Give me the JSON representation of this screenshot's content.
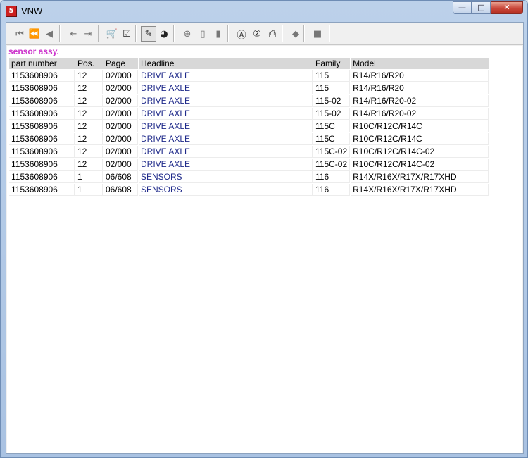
{
  "window": {
    "title": "VNW",
    "icon": "app-icon",
    "min_symbol": "—",
    "max_symbol": "□",
    "close_symbol": "✕"
  },
  "toolbar": {
    "buttons": [
      {
        "name": "first-record-icon",
        "glyph": "⏮"
      },
      {
        "name": "previous-page-icon",
        "glyph": "⏪"
      },
      {
        "name": "previous-record-icon",
        "glyph": "◀"
      },
      {
        "name": "export-icon",
        "glyph": "⇤"
      },
      {
        "name": "import-icon",
        "glyph": "⇥"
      },
      {
        "name": "cart-icon",
        "glyph": "🛒"
      },
      {
        "name": "checklist-icon",
        "glyph": "☑"
      },
      {
        "name": "bookmark-icon",
        "glyph": "✎"
      },
      {
        "name": "globe-icon",
        "glyph": "◕"
      },
      {
        "name": "zoom-in-icon",
        "glyph": "⊕"
      },
      {
        "name": "page-icon",
        "glyph": "▯"
      },
      {
        "name": "page-copy-icon",
        "glyph": "▮"
      },
      {
        "name": "search-a-icon",
        "glyph": "Ⓐ"
      },
      {
        "name": "search-2-icon",
        "glyph": "②"
      },
      {
        "name": "print-icon",
        "glyph": "⎙"
      },
      {
        "name": "erase-icon",
        "glyph": "◆"
      },
      {
        "name": "stop-icon",
        "glyph": "■"
      }
    ]
  },
  "heading": "sensor assy.",
  "table": {
    "columns": [
      "part number",
      "Pos.",
      "Page",
      "Headline",
      "Family",
      "Model"
    ],
    "rows": [
      [
        "1153608906",
        "12",
        "02/000",
        "DRIVE AXLE",
        "115",
        "R14/R16/R20"
      ],
      [
        "1153608906",
        "12",
        "02/000",
        "DRIVE AXLE",
        "115",
        "R14/R16/R20"
      ],
      [
        "1153608906",
        "12",
        "02/000",
        "DRIVE AXLE",
        "115-02",
        "R14/R16/R20-02"
      ],
      [
        "1153608906",
        "12",
        "02/000",
        "DRIVE AXLE",
        "115-02",
        "R14/R16/R20-02"
      ],
      [
        "1153608906",
        "12",
        "02/000",
        "DRIVE AXLE",
        "115C",
        "R10C/R12C/R14C"
      ],
      [
        "1153608906",
        "12",
        "02/000",
        "DRIVE AXLE",
        "115C",
        "R10C/R12C/R14C"
      ],
      [
        "1153608906",
        "12",
        "02/000",
        "DRIVE AXLE",
        "115C-02",
        "R10C/R12C/R14C-02"
      ],
      [
        "1153608906",
        "12",
        "02/000",
        "DRIVE AXLE",
        "115C-02",
        "R10C/R12C/R14C-02"
      ],
      [
        "1153608906",
        "1",
        "06/608",
        "SENSORS",
        "116",
        "R14X/R16X/R17X/R17XHD"
      ],
      [
        "1153608906",
        "1",
        "06/608",
        "SENSORS",
        "116",
        "R14X/R16X/R17X/R17XHD"
      ]
    ]
  },
  "colors": {
    "heading": "#cc33cc",
    "link": "#1f2a8a",
    "header_bg": "#d8d8d8"
  }
}
